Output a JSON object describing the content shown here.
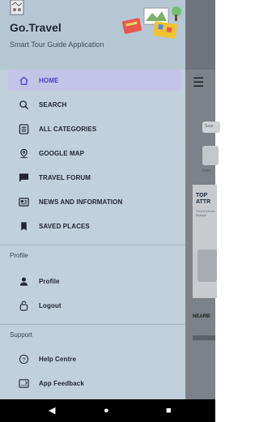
{
  "app": {
    "name": "Go.Travel",
    "tagline": "Smart Tour Guide Application"
  },
  "drawer": {
    "main_items": [
      {
        "label": "HOME",
        "icon": "home-icon",
        "active": true
      },
      {
        "label": "SEARCH",
        "icon": "search-icon",
        "active": false
      },
      {
        "label": "ALL CATEGORIES",
        "icon": "list-icon",
        "active": false
      },
      {
        "label": "GOOGLE MAP",
        "icon": "map-pin-icon",
        "active": false
      },
      {
        "label": "TRAVEL FORUM",
        "icon": "forum-icon",
        "active": false
      },
      {
        "label": "NEWS AND INFORMATION",
        "icon": "news-icon",
        "active": false
      },
      {
        "label": "SAVED PLACES",
        "icon": "bookmark-icon",
        "active": false
      }
    ],
    "profile_section": {
      "title": "Profile",
      "items": [
        {
          "label": "Profile",
          "icon": "person-icon"
        },
        {
          "label": "Logout",
          "icon": "logout-icon"
        }
      ]
    },
    "support_section": {
      "title": "Support",
      "items": [
        {
          "label": "Help Centre",
          "icon": "help-icon"
        },
        {
          "label": "App Feedback",
          "icon": "feedback-icon"
        }
      ]
    }
  },
  "background_screen": {
    "search_placeholder": "Sear",
    "category_label": "Natu",
    "card_title": "TOP\nATTR",
    "card_subtitle": "Your d the be Malays",
    "nearby_label": "NEARB"
  },
  "system_nav": {
    "back": "◀",
    "home": "●",
    "recents": "■"
  },
  "colors": {
    "drawer_bg": "#c0d0dc",
    "active_bg": "#c4c3e8",
    "active_text": "#4b3fc4",
    "text": "#1e2530"
  }
}
